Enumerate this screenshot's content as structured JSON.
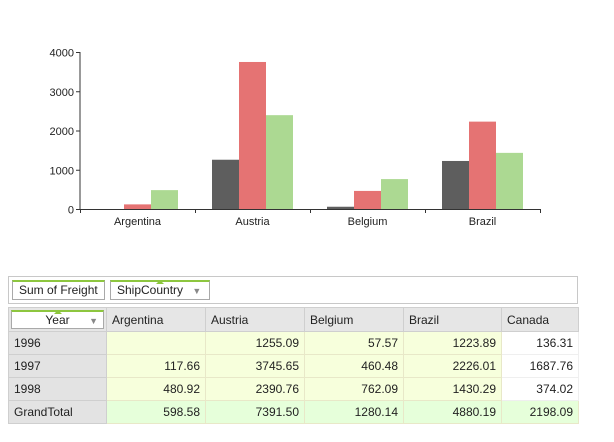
{
  "chart_data": {
    "type": "bar",
    "categories": [
      "Argentina",
      "Austria",
      "Belgium",
      "Brazil"
    ],
    "series": [
      {
        "values": [
          0,
          1255.09,
          57.57,
          1223.89
        ],
        "color": "#5e5e5e"
      },
      {
        "values": [
          117.66,
          3745.65,
          460.48,
          2226.01
        ],
        "color": "#e57373"
      },
      {
        "values": [
          480.92,
          2390.76,
          762.09,
          1430.29
        ],
        "color": "#acd992"
      }
    ],
    "yticks": [
      "0",
      "1000",
      "2000",
      "3000",
      "4000"
    ],
    "ylim": [
      0,
      4000
    ],
    "grid": false
  },
  "pivot": {
    "data_field": "Sum of Freight",
    "column_field": "ShipCountry",
    "row_field": "Year",
    "filter_icon": "filter-funnel-icon",
    "columns": [
      "Argentina",
      "Austria",
      "Belgium",
      "Brazil",
      "Canada"
    ],
    "rows": [
      {
        "label": "1996",
        "cells": [
          "",
          "1255.09",
          "57.57",
          "1223.89",
          "136.31"
        ]
      },
      {
        "label": "1997",
        "cells": [
          "117.66",
          "3745.65",
          "460.48",
          "2226.01",
          "1687.76"
        ]
      },
      {
        "label": "1998",
        "cells": [
          "480.92",
          "2390.76",
          "762.09",
          "1430.29",
          "374.02"
        ]
      },
      {
        "label": "GrandTotal",
        "cells": [
          "598.58",
          "7391.50",
          "1280.14",
          "4880.19",
          "2198.09"
        ]
      }
    ],
    "colors": {
      "accent": "#8dc63f",
      "cell": "#f7ffdc",
      "total": "#e6ffda",
      "header": "#e6e6e6"
    }
  }
}
